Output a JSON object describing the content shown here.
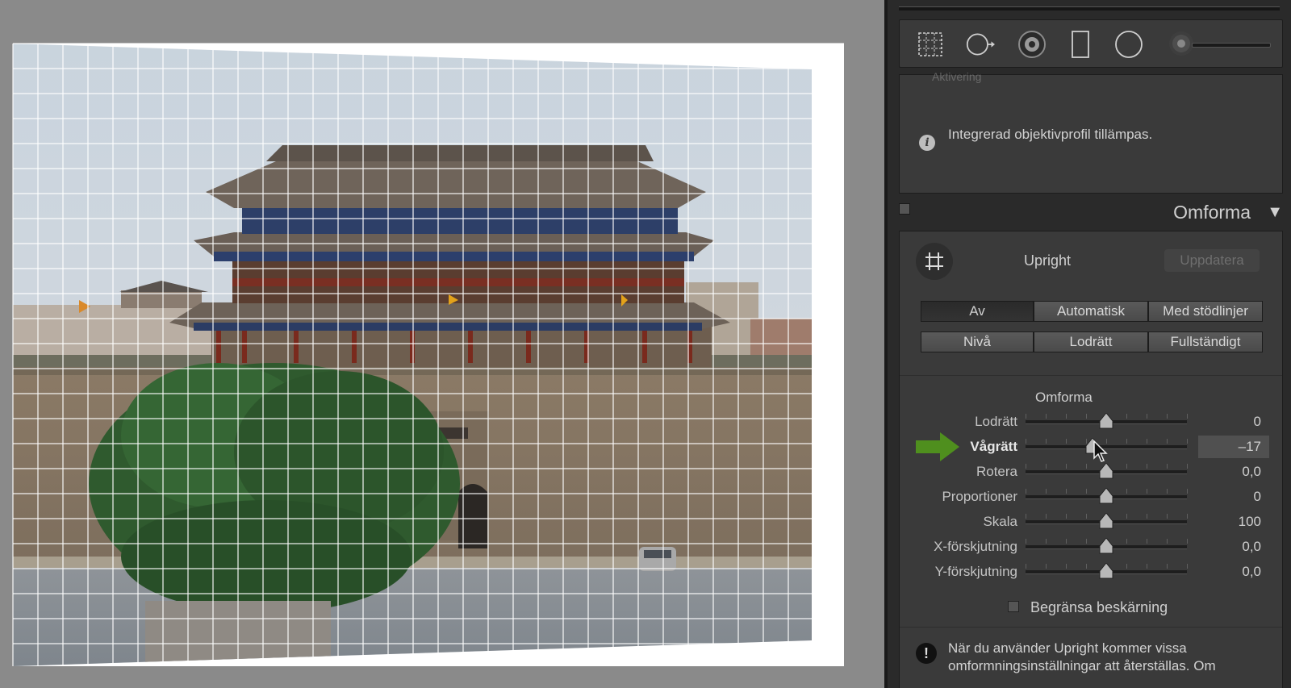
{
  "lens_panel": {
    "cut_off_text": "Aktivering",
    "info_text": "Integrerad objektivprofil tillämpas."
  },
  "section": {
    "title": "Omforma",
    "collapse_arrow": "▼"
  },
  "upright": {
    "label": "Upright",
    "update_button": "Uppdatera",
    "buttons": [
      "Av",
      "Automatisk",
      "Med stödlinjer",
      "Nivå",
      "Lodrätt",
      "Fullständigt"
    ],
    "active": "Av"
  },
  "transform": {
    "title": "Omforma",
    "sliders": [
      {
        "label": "Lodrätt",
        "value": "0",
        "position": 0.5
      },
      {
        "label": "Vågrätt",
        "value": "–17",
        "position": 0.415,
        "highlighted": true
      },
      {
        "label": "Rotera",
        "value": "0,0",
        "position": 0.5
      },
      {
        "label": "Proportioner",
        "value": "0",
        "position": 0.5
      },
      {
        "label": "Skala",
        "value": "100",
        "position": 0.5
      },
      {
        "label": "X-förskjutning",
        "value": "0,0",
        "position": 0.5
      },
      {
        "label": "Y-förskjutning",
        "value": "0,0",
        "position": 0.5
      }
    ],
    "constrain_crop_label": "Begränsa beskärning",
    "constrain_crop_checked": false
  },
  "warning": {
    "text": "När du använder Upright kommer vissa omformningsinställningar att återställas. Om"
  },
  "colors": {
    "panel_bg": "#3a3a3a",
    "pointer_arrow": "#4f8f1e",
    "sky": "#cdd6de",
    "wall": "#8e7d68",
    "tree": "#2e5a2c"
  },
  "icons": [
    "marquee-grid-icon",
    "spot-removal-icon",
    "red-eye-icon",
    "graduated-filter-icon",
    "radial-filter-icon",
    "adjustment-brush-icon",
    "crop-icon",
    "info-icon",
    "warning-icon"
  ]
}
